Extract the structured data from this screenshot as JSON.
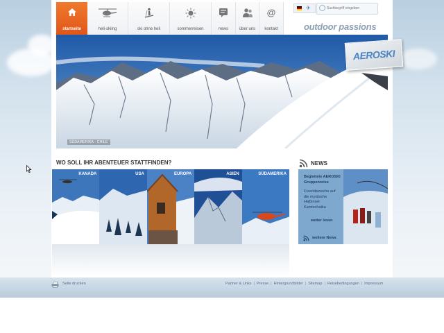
{
  "nav": {
    "items": [
      {
        "label": "startseite",
        "icon": "home-icon",
        "active": true
      },
      {
        "label": "heli-skiing",
        "icon": "helicopter-icon",
        "active": false
      },
      {
        "label": "ski ohne heli",
        "icon": "skier-icon",
        "active": false
      },
      {
        "label": "sommerreisen",
        "icon": "sun-icon",
        "active": false
      },
      {
        "label": "news",
        "icon": "news-icon",
        "active": false
      },
      {
        "label": "über uns",
        "icon": "people-icon",
        "active": false
      },
      {
        "label": "kontakt",
        "icon": "at-icon",
        "active": false
      }
    ]
  },
  "header": {
    "search_placeholder": "Suchbegriff eingeben",
    "slogan": "outdoor passions",
    "brand_badge": "AEROSKI"
  },
  "hero": {
    "caption": "SÜDAMERIKA - CHILE"
  },
  "destinations": {
    "title": "WO SOLL IHR ABENTEUER STATTFINDEN?",
    "items": [
      {
        "name": "KANADA"
      },
      {
        "name": "USA"
      },
      {
        "name": "EUROPA"
      },
      {
        "name": "ASIEN"
      },
      {
        "name": "SÜDAMERIKA"
      }
    ]
  },
  "news": {
    "title": "NEWS",
    "headline": "Begleitete AEROSKI Gruppenreise",
    "body": "Freeridewoche auf die mystische Halbinsel Kamtschatka",
    "read_more": "weiter lesen",
    "more_news": "weitere News"
  },
  "footer": {
    "print_label": "Seite drucken",
    "links": [
      "Partner & Links",
      "Presse",
      "Hintergrundbilder",
      "Sitemap",
      "Reisebedingungen",
      "Impressum"
    ]
  },
  "colors": {
    "accent_orange": "#e8651f",
    "news_blue": "#7fa8cf",
    "footer_blue": "#c3d4e2"
  }
}
